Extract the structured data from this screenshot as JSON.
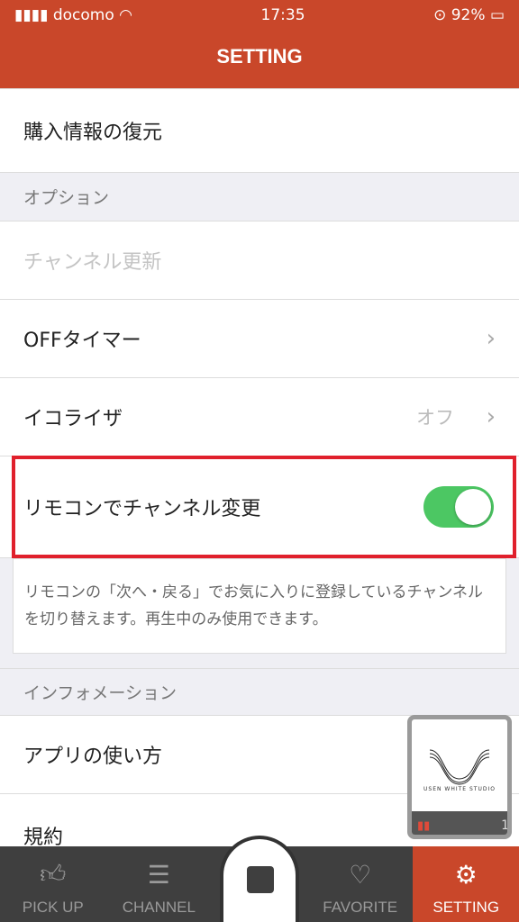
{
  "status": {
    "carrier": "docomo",
    "time": "17:35",
    "battery": "92%"
  },
  "header": {
    "title": "SETTING"
  },
  "rows": {
    "restore": "購入情報の復元",
    "channel_update": "チャンネル更新",
    "off_timer": "OFFタイマー",
    "equalizer": "イコライザ",
    "equalizer_value": "オフ",
    "remote": "リモコンでチャンネル変更",
    "howto": "アプリの使い方",
    "terms": "規約"
  },
  "remote_toggle": {
    "on": true,
    "color": "#4cc763"
  },
  "sections": {
    "options": "オプション",
    "info": "インフォメーション"
  },
  "description": "リモコンの「次へ・戻る」でお気に入りに登録しているチャンネルを切り替えます。再生中のみ使用できます。",
  "mini_player": {
    "logo": "USEN WHITE STUDIO",
    "count": "1"
  },
  "tabs": [
    {
      "label": "PICK UP",
      "icon": "thumbs-up"
    },
    {
      "label": "CHANNEL",
      "icon": "list"
    },
    {
      "label": "FAVORITE",
      "icon": "heart"
    },
    {
      "label": "SETTING",
      "icon": "gear",
      "active": true
    }
  ],
  "colors": {
    "accent": "#c9472a",
    "highlight_box": "#e0202c"
  }
}
